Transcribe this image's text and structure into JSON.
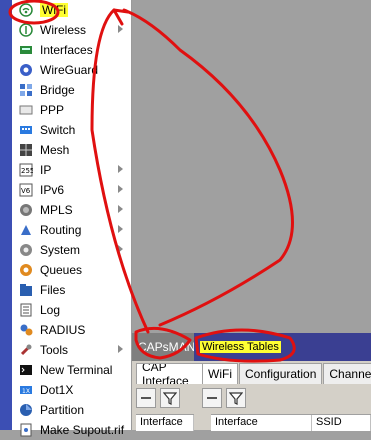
{
  "menu": {
    "items": [
      {
        "label": "WiFi",
        "icon": "wifi-icon",
        "highlight": true,
        "arrow": false
      },
      {
        "label": "Wireless",
        "icon": "wireless-icon",
        "highlight": false,
        "arrow": true
      },
      {
        "label": "Interfaces",
        "icon": "interfaces-icon",
        "highlight": false,
        "arrow": false
      },
      {
        "label": "WireGuard",
        "icon": "wireguard-icon",
        "highlight": false,
        "arrow": false
      },
      {
        "label": "Bridge",
        "icon": "bridge-icon",
        "highlight": false,
        "arrow": false
      },
      {
        "label": "PPP",
        "icon": "ppp-icon",
        "highlight": false,
        "arrow": false
      },
      {
        "label": "Switch",
        "icon": "switch-icon",
        "highlight": false,
        "arrow": false
      },
      {
        "label": "Mesh",
        "icon": "mesh-icon",
        "highlight": false,
        "arrow": false
      },
      {
        "label": "IP",
        "icon": "ip-icon",
        "highlight": false,
        "arrow": true
      },
      {
        "label": "IPv6",
        "icon": "ipv6-icon",
        "highlight": false,
        "arrow": true
      },
      {
        "label": "MPLS",
        "icon": "mpls-icon",
        "highlight": false,
        "arrow": true
      },
      {
        "label": "Routing",
        "icon": "routing-icon",
        "highlight": false,
        "arrow": true
      },
      {
        "label": "System",
        "icon": "system-icon",
        "highlight": false,
        "arrow": true
      },
      {
        "label": "Queues",
        "icon": "queues-icon",
        "highlight": false,
        "arrow": false
      },
      {
        "label": "Files",
        "icon": "files-icon",
        "highlight": false,
        "arrow": false
      },
      {
        "label": "Log",
        "icon": "log-icon",
        "highlight": false,
        "arrow": false
      },
      {
        "label": "RADIUS",
        "icon": "radius-icon",
        "highlight": false,
        "arrow": false
      },
      {
        "label": "Tools",
        "icon": "tools-icon",
        "highlight": false,
        "arrow": true
      },
      {
        "label": "New Terminal",
        "icon": "terminal-icon",
        "highlight": false,
        "arrow": false
      },
      {
        "label": "Dot1X",
        "icon": "dot1x-icon",
        "highlight": false,
        "arrow": false
      },
      {
        "label": "Partition",
        "icon": "partition-icon",
        "highlight": false,
        "arrow": false
      },
      {
        "label": "Make Supout.rif",
        "icon": "supout-icon",
        "highlight": false,
        "arrow": false
      }
    ]
  },
  "windows": {
    "capsman": {
      "title": "CAPsMAN",
      "tab": "CAP Interface",
      "column": "Interface"
    },
    "wireless_tables": {
      "title": "Wireless Tables",
      "tabs": [
        "WiFi",
        "Configuration",
        "Channel"
      ],
      "columns": [
        "Interface",
        "SSID"
      ]
    }
  },
  "colors": {
    "highlight": "#ffff33",
    "annotation": "#e01010",
    "title_bar_active": "#3a3f92",
    "title_bar_inactive": "#7f7f7f",
    "left_strip": "#3c4fb4"
  }
}
